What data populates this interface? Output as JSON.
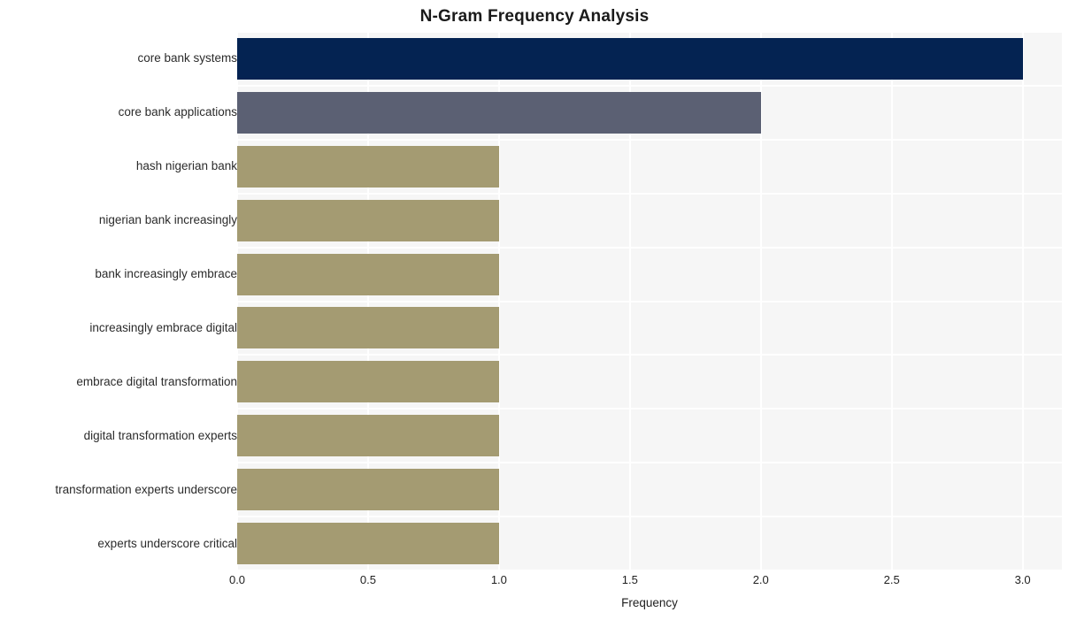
{
  "chart_data": {
    "type": "bar",
    "orientation": "horizontal",
    "title": "N-Gram Frequency Analysis",
    "xlabel": "Frequency",
    "ylabel": "",
    "xlim": [
      0,
      3.15
    ],
    "xticks": [
      "0.0",
      "0.5",
      "1.0",
      "1.5",
      "2.0",
      "2.5",
      "3.0"
    ],
    "xtick_values": [
      0,
      0.5,
      1,
      1.5,
      2,
      2.5,
      3
    ],
    "grid": true,
    "legend": "none",
    "categories": [
      "core bank systems",
      "core bank applications",
      "hash nigerian bank",
      "nigerian bank increasingly",
      "bank increasingly embrace",
      "increasingly embrace digital",
      "embrace digital transformation",
      "digital transformation experts",
      "transformation experts underscore",
      "experts underscore critical"
    ],
    "values": [
      3,
      2,
      1,
      1,
      1,
      1,
      1,
      1,
      1,
      1
    ],
    "bar_colors": [
      "#042352",
      "#5b6073",
      "#a49b72",
      "#a49b72",
      "#a49b72",
      "#a49b72",
      "#a49b72",
      "#a49b72",
      "#a49b72",
      "#a49b72"
    ],
    "colors": {
      "plot_background": "#f6f6f6",
      "figure_background": "#ffffff",
      "gridline": "#ffffff",
      "title_text": "#1a1a1a",
      "tick_text": "#2b2b2b",
      "bar_high": "#042352",
      "bar_mid": "#5b6073",
      "bar_low": "#a49b72"
    }
  }
}
